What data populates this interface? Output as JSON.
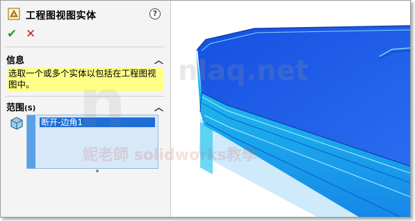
{
  "panel": {
    "title": "工程图视图实体",
    "help_symbol": "?",
    "ok_symbol": "✔",
    "cancel_symbol": "✕",
    "info": {
      "header": "信息",
      "text": "选取一个或多个实体以包括在工程图视图中。"
    },
    "scope": {
      "header": "范围",
      "shortcut": "(S)",
      "items": [
        "断开-边角1"
      ]
    }
  },
  "watermark": {
    "line1": "nlaq.net",
    "line2": "妮老師 solidworks教學"
  },
  "colors": {
    "accent_blue": "#1e6ed8",
    "info_yellow": "#ffff88",
    "model_blue": "#1a5ee8",
    "model_cyan": "#26d6f0"
  }
}
